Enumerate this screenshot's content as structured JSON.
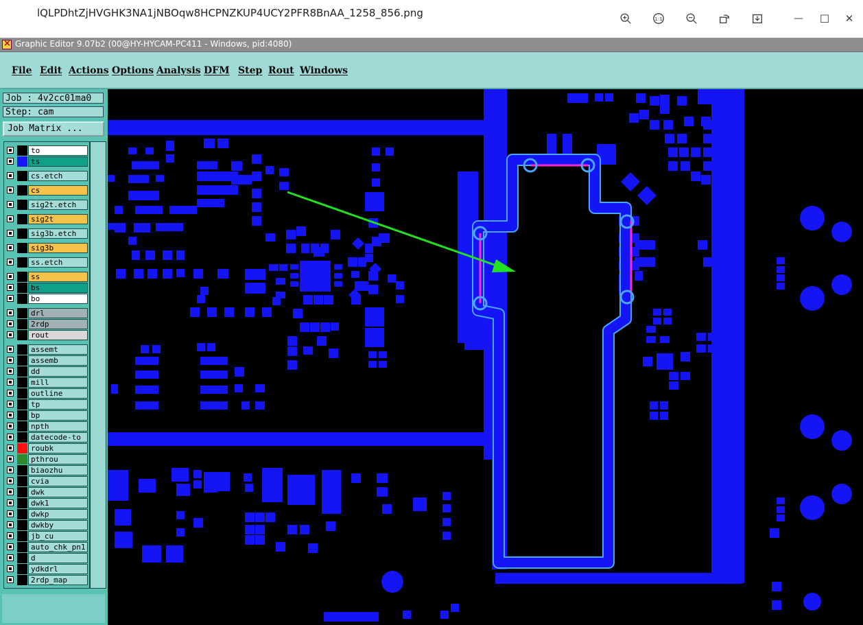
{
  "viewer": {
    "filename": "lQLPDhtZjHVGHK3NA1jNBOqw8HCPNZKUP4UCY2PFR8BnAA_1258_856.png",
    "buttons": [
      "zoom-in-icon",
      "actual-size-icon",
      "zoom-out-icon",
      "rotate-icon",
      "download-icon"
    ],
    "minimize": "—",
    "maximize": "☐",
    "close": "✕"
  },
  "app": {
    "title": "Graphic Editor 9.07b2 (00@HY-HYCAM-PC411 - Windows, pid:4080)"
  },
  "menu": [
    "File",
    "Edit",
    "Actions",
    "Options",
    "Analysis",
    "DFM",
    "Step",
    "Rout",
    "Windows"
  ],
  "panel": {
    "job": "Job : 4v2cc01ma0",
    "step": "Step: cam",
    "job_matrix": "Job Matrix ..."
  },
  "layers": [
    {
      "name": "to",
      "bg": "#ffffff",
      "swatch": "#000000"
    },
    {
      "name": "ts",
      "bg": "#10a08a",
      "swatch": "#1818ff"
    },
    {
      "name": "cs.etch",
      "bg": "#a4dcd8",
      "swatch": "#000000"
    },
    {
      "name": "cs",
      "bg": "#f6c24a",
      "swatch": "#000000"
    },
    {
      "name": "sig2t.etch",
      "bg": "#a4dcd8",
      "swatch": "#000000"
    },
    {
      "name": "sig2t",
      "bg": "#f6c24a",
      "swatch": "#000000"
    },
    {
      "name": "sig3b.etch",
      "bg": "#a4dcd8",
      "swatch": "#000000"
    },
    {
      "name": "sig3b",
      "bg": "#f6c24a",
      "swatch": "#000000"
    },
    {
      "name": "ss.etch",
      "bg": "#a4dcd8",
      "swatch": "#000000"
    },
    {
      "name": "ss",
      "bg": "#f6c24a",
      "swatch": "#000000"
    },
    {
      "name": "bs",
      "bg": "#10a08a",
      "swatch": "#000000"
    },
    {
      "name": "bo",
      "bg": "#ffffff",
      "swatch": "#000000"
    },
    {
      "name": "drl",
      "bg": "#a0b0b4",
      "swatch": "#000000"
    },
    {
      "name": "2rdp",
      "bg": "#a0b0b4",
      "swatch": "#000000"
    },
    {
      "name": "rout",
      "bg": "#d8d8d8",
      "swatch": "#000000"
    },
    {
      "name": "assemt",
      "bg": "#a4dcd8",
      "swatch": "#000000"
    },
    {
      "name": "assemb",
      "bg": "#a4dcd8",
      "swatch": "#000000"
    },
    {
      "name": "dd",
      "bg": "#a4dcd8",
      "swatch": "#000000"
    },
    {
      "name": "mill",
      "bg": "#a4dcd8",
      "swatch": "#000000"
    },
    {
      "name": "outline",
      "bg": "#a4dcd8",
      "swatch": "#000000"
    },
    {
      "name": "tp",
      "bg": "#a4dcd8",
      "swatch": "#000000"
    },
    {
      "name": "bp",
      "bg": "#a4dcd8",
      "swatch": "#000000"
    },
    {
      "name": "npth",
      "bg": "#a4dcd8",
      "swatch": "#000000"
    },
    {
      "name": "datecode-to",
      "bg": "#a4dcd8",
      "swatch": "#000000"
    },
    {
      "name": "roubk",
      "bg": "#a4dcd8",
      "swatch": "#ff1010"
    },
    {
      "name": "pthrou",
      "bg": "#a4dcd8",
      "swatch": "#2e8b2e"
    },
    {
      "name": "biaozhu",
      "bg": "#a4dcd8",
      "swatch": "#000000"
    },
    {
      "name": "cvia",
      "bg": "#a4dcd8",
      "swatch": "#000000"
    },
    {
      "name": "dwk",
      "bg": "#a4dcd8",
      "swatch": "#000000"
    },
    {
      "name": "dwk1",
      "bg": "#a4dcd8",
      "swatch": "#000000"
    },
    {
      "name": "dwkp",
      "bg": "#a4dcd8",
      "swatch": "#000000"
    },
    {
      "name": "dwkby",
      "bg": "#a4dcd8",
      "swatch": "#000000"
    },
    {
      "name": "jb_cu",
      "bg": "#a4dcd8",
      "swatch": "#000000"
    },
    {
      "name": "auto_chk_pn1",
      "bg": "#a4dcd8",
      "swatch": "#000000"
    },
    {
      "name": "d",
      "bg": "#a4dcd8",
      "swatch": "#000000"
    },
    {
      "name": "ydkdrl",
      "bg": "#a4dcd8",
      "swatch": "#000000"
    },
    {
      "name": "2rdp_map",
      "bg": "#a4dcd8",
      "swatch": "#000000"
    }
  ],
  "colors": {
    "copper": "#1414f5",
    "outline_light": "#4aa6ff",
    "highlight": "#ff2ad4",
    "arrow": "#22e022",
    "canvas_bg": "#000000"
  }
}
